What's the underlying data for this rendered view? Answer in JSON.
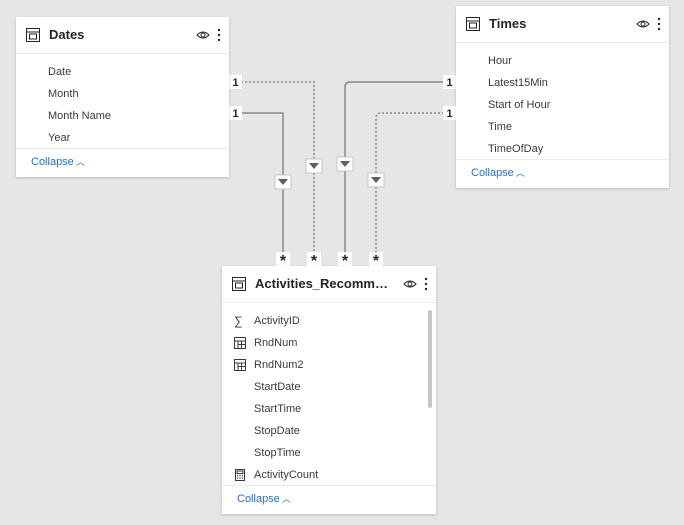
{
  "tables": {
    "dates": {
      "title": "Dates",
      "fields": [
        {
          "label": "Date",
          "icon": "none"
        },
        {
          "label": "Month",
          "icon": "none"
        },
        {
          "label": "Month Name",
          "icon": "none"
        },
        {
          "label": "Year",
          "icon": "none"
        }
      ],
      "collapse_label": "Collapse"
    },
    "times": {
      "title": "Times",
      "fields": [
        {
          "label": "Hour",
          "icon": "none"
        },
        {
          "label": "Latest15Min",
          "icon": "none"
        },
        {
          "label": "Start of Hour",
          "icon": "none"
        },
        {
          "label": "Time",
          "icon": "none"
        },
        {
          "label": "TimeOfDay",
          "icon": "none"
        }
      ],
      "collapse_label": "Collapse"
    },
    "activities": {
      "title": "Activities_Recommen...",
      "fields": [
        {
          "label": "ActivityID",
          "icon": "sigma-icon"
        },
        {
          "label": "RndNum",
          "icon": "calc-column-icon"
        },
        {
          "label": "RndNum2",
          "icon": "calc-column-icon"
        },
        {
          "label": "StartDate",
          "icon": "none"
        },
        {
          "label": "StartTime",
          "icon": "none"
        },
        {
          "label": "StopDate",
          "icon": "none"
        },
        {
          "label": "StopTime",
          "icon": "none"
        },
        {
          "label": "ActivityCount",
          "icon": "calculator-icon"
        }
      ],
      "collapse_label": "Collapse"
    }
  },
  "relationships": {
    "one_marker": "1",
    "many_marker": "*"
  },
  "colors": {
    "canvas": "#e6e6e6",
    "line": "#8a8886",
    "link": "#2a6fc9"
  }
}
